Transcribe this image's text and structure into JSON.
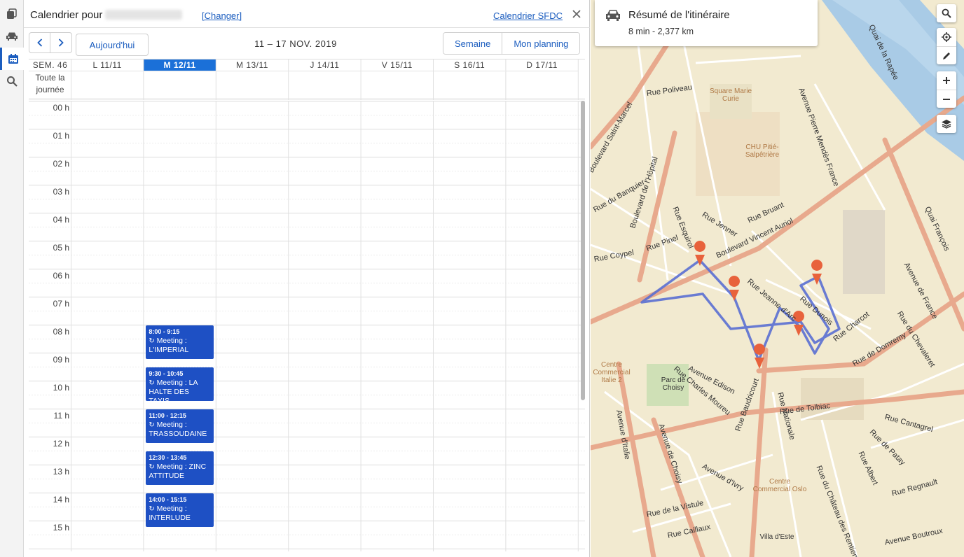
{
  "rail": {
    "items": [
      {
        "name": "tabs-icon"
      },
      {
        "name": "car-icon"
      },
      {
        "name": "calendar-icon"
      },
      {
        "name": "search-icon"
      }
    ]
  },
  "calendar": {
    "title": "Calendrier pour",
    "change_label": "[Changer]",
    "sfdc_label": "Calendrier SFDC",
    "today_label": "Aujourd'hui",
    "range": "11 – 17 NOV. 2019",
    "views": [
      "Semaine",
      "Mon planning"
    ],
    "week_label": "SEM. 46",
    "days": [
      "L 11/11",
      "M 12/11",
      "M 13/11",
      "J 14/11",
      "V 15/11",
      "S 16/11",
      "D 17/11"
    ],
    "today_index": 1,
    "allday_label": "Toute la journée",
    "hours": [
      "00 h",
      "01 h",
      "02 h",
      "03 h",
      "04 h",
      "05 h",
      "06 h",
      "07 h",
      "08 h",
      "09 h",
      "10 h",
      "11 h",
      "12 h",
      "13 h",
      "14 h",
      "15 h"
    ],
    "events": [
      {
        "time": "8:00 - 9:15",
        "title": "Meeting : L'IMPERIAL",
        "day": 1,
        "start_hour": 8.0
      },
      {
        "time": "9:30 - 10:45",
        "title": "Meeting : LA HALTE DES TAXIS",
        "day": 1,
        "start_hour": 9.5
      },
      {
        "time": "11:00 - 12:15",
        "title": "Meeting : TRASSOUDAINE",
        "day": 1,
        "start_hour": 11.0
      },
      {
        "time": "12:30 - 13:45",
        "title": "Meeting : ZINC ATTITUDE",
        "day": 1,
        "start_hour": 12.5
      },
      {
        "time": "14:00 - 15:15",
        "title": "Meeting : INTERLUDE",
        "day": 1,
        "start_hour": 14.0
      }
    ]
  },
  "map": {
    "route_title": "Résumé de l'itinéraire",
    "route_summary": "8 min - 2,377 km",
    "accent": "#5a6fd1",
    "marker_color": "#e8623c",
    "streets": [
      "Boulevard Vincent Auriol",
      "Rue de Tolbiac",
      "Avenue d'Italie",
      "Avenue de Choisy",
      "Boulevard de l'Hôpital",
      "Rue Jeanne d'Arc",
      "Rue Nationale",
      "Rue Baudricourt",
      "Avenue Edison",
      "Rue Charcot",
      "Rue de Domremy",
      "Rue Esquirol",
      "Rue Pinel",
      "Rue Jenner",
      "Rue Bruant",
      "Rue Poliveau",
      "Quai de la Rapée",
      "Quai François",
      "Avenue de France",
      "Rue du Chevaleret",
      "Rue Dunois",
      "Rue du Château des Rentiers",
      "Rue Albert",
      "Rue Regnault",
      "Avenue d'Ivry",
      "Rue Caillaux",
      "Rue de la Vistule",
      "Avenue Pierre Mendès France",
      "Rue de Patay",
      "Rue Cantagrel",
      "Boulevard Saint-Marcel",
      "Rue du Banquier",
      "Rue Coypel",
      "Rue Charles Moureu",
      "Avenue Boutroux"
    ],
    "pois": [
      "Square Marie Curie",
      "CHU Pitié-Salpêtrière",
      "Parc de Choisy",
      "Centre Commercial Oslo",
      "Centre Commercial Italie 2",
      "Villa d'Este"
    ]
  }
}
